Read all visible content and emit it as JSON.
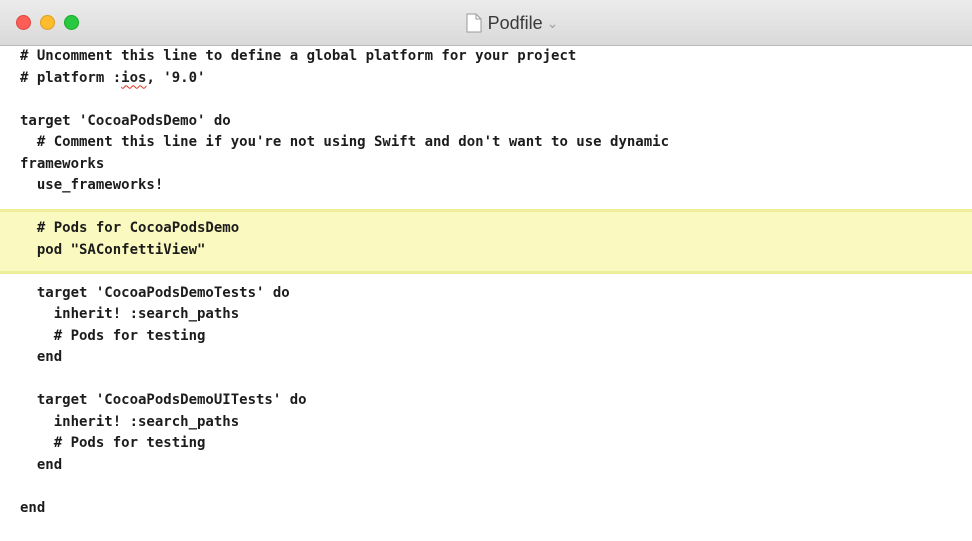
{
  "window": {
    "title": "Podfile",
    "title_chevron": "⌄",
    "document_icon": "document-icon"
  },
  "controls": {
    "close_color": "#fc5d57",
    "minimize_color": "#fdbc2e",
    "zoom_color": "#28c840"
  },
  "editor": {
    "highlight_color": "#fafac0",
    "misspelled_word": "ios",
    "lines": [
      "# Uncomment this line to define a global platform for your project",
      "# platform :ios, '9.0'",
      "",
      "target 'CocoaPodsDemo' do",
      "  # Comment this line if you're not using Swift and don't want to use dynamic",
      "frameworks",
      "  use_frameworks!",
      "",
      "  # Pods for CocoaPodsDemo",
      "  pod \"SAConfettiView\"",
      "",
      "  target 'CocoaPodsDemoTests' do",
      "    inherit! :search_paths",
      "    # Pods for testing",
      "  end",
      "",
      "  target 'CocoaPodsDemoUITests' do",
      "    inherit! :search_paths",
      "    # Pods for testing",
      "  end",
      "",
      "end"
    ]
  }
}
